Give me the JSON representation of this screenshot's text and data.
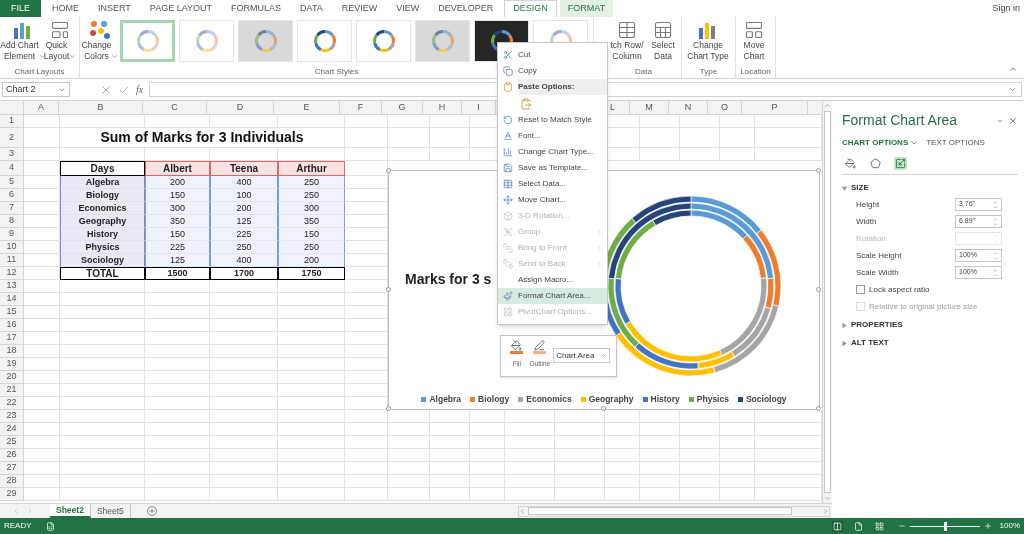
{
  "ribbon_tabs": [
    {
      "label": "FILE",
      "kind": "file",
      "selected": false
    },
    {
      "label": "HOME",
      "kind": "normal",
      "selected": false
    },
    {
      "label": "INSERT",
      "kind": "normal",
      "selected": false
    },
    {
      "label": "PAGE LAYOUT",
      "kind": "normal",
      "selected": false
    },
    {
      "label": "FORMULAS",
      "kind": "normal",
      "selected": false
    },
    {
      "label": "DATA",
      "kind": "normal",
      "selected": false
    },
    {
      "label": "REVIEW",
      "kind": "normal",
      "selected": false
    },
    {
      "label": "VIEW",
      "kind": "normal",
      "selected": false
    },
    {
      "label": "DEVELOPER",
      "kind": "normal",
      "selected": false
    },
    {
      "label": "DESIGN",
      "kind": "contextual",
      "selected": true
    },
    {
      "label": "FORMAT",
      "kind": "contextual",
      "selected": false
    }
  ],
  "account": {
    "label": "Sign in"
  },
  "ribbon": {
    "groups": [
      {
        "label": "Chart Layouts",
        "buttons": [
          {
            "label": "Add Chart\nElement",
            "dropdown": true
          },
          {
            "label": "Quick\nLayout",
            "dropdown": true
          }
        ]
      },
      {
        "label": "Chart Styles",
        "buttons": [
          {
            "label": "Change\nColors",
            "dropdown": true
          }
        ],
        "gallery": [
          {
            "kind": "light",
            "selected": true
          },
          {
            "kind": "light",
            "selected": false
          },
          {
            "kind": "gray",
            "selected": false
          },
          {
            "kind": "vivid",
            "selected": false
          },
          {
            "kind": "vivid",
            "selected": false
          },
          {
            "kind": "gray",
            "selected": false
          },
          {
            "kind": "dark",
            "selected": false
          },
          {
            "kind": "light",
            "selected": false
          }
        ]
      },
      {
        "label": "Data",
        "buttons": [
          {
            "label": "tch Row/\nColumn",
            "dropdown": false
          },
          {
            "label": "Select\nData",
            "dropdown": false
          }
        ]
      },
      {
        "label": "Type",
        "buttons": [
          {
            "label": "Change\nChart Type",
            "dropdown": false
          }
        ]
      },
      {
        "label": "Location",
        "buttons": [
          {
            "label": "Move\nChart",
            "dropdown": false
          }
        ]
      }
    ]
  },
  "formula_bar": {
    "name_box": "Chart 2",
    "function_label": "fx"
  },
  "sheet": {
    "column_headers": [
      "A",
      "B",
      "C",
      "D",
      "E",
      "F",
      "G",
      "H",
      "I",
      "L",
      "M",
      "N",
      "O",
      "P"
    ],
    "row_numbers": [
      "1",
      "2",
      "3",
      "4",
      "5",
      "6",
      "7",
      "8",
      "9",
      "10",
      "11",
      "12",
      "13",
      "14",
      "15",
      "16",
      "17",
      "18",
      "19",
      "20",
      "21",
      "22",
      "23",
      "24",
      "25",
      "26",
      "27",
      "28",
      "29"
    ],
    "title": "Sum of Marks for 3 Individuals",
    "table": {
      "header": [
        "Days",
        "Albert",
        "Teena",
        "Arthur"
      ],
      "rows": [
        [
          "Algebra",
          "200",
          "400",
          "250"
        ],
        [
          "Biology",
          "150",
          "100",
          "250"
        ],
        [
          "Economics",
          "300",
          "200",
          "300"
        ],
        [
          "Geography",
          "350",
          "125",
          "350"
        ],
        [
          "History",
          "150",
          "225",
          "150"
        ],
        [
          "Physics",
          "225",
          "250",
          "250"
        ],
        [
          "Sociology",
          "125",
          "400",
          "200"
        ]
      ],
      "total": [
        "TOTAL",
        "1500",
        "1700",
        "1750"
      ]
    }
  },
  "chart": {
    "title": "Marks for 3 s",
    "chart_data": {
      "type": "donut",
      "categories": [
        "Algebra",
        "Biology",
        "Economics",
        "Geography",
        "History",
        "Physics",
        "Sociology"
      ],
      "series": [
        {
          "colors": [
            "#5b9bd5",
            "#ed7d31",
            "#a5a5a5",
            "#ffc000",
            "#4472c4",
            "#70ad47",
            "#264478"
          ],
          "values": [
            13.3,
            10,
            20,
            23.3,
            10,
            15,
            8.4
          ]
        },
        {
          "colors": [
            "#5b9bd5",
            "#ed7d31",
            "#a5a5a5",
            "#ffc000",
            "#4472c4",
            "#70ad47",
            "#264478"
          ],
          "values": [
            23.5,
            5.9,
            11.8,
            7.4,
            13.2,
            14.7,
            23.5
          ]
        },
        {
          "colors": [
            "#5b9bd5",
            "#ed7d31",
            "#a5a5a5",
            "#ffc000",
            "#4472c4",
            "#70ad47",
            "#264478"
          ],
          "values": [
            14.3,
            14.3,
            17.1,
            20,
            8.6,
            14.3,
            11.4
          ]
        }
      ]
    }
  },
  "mini_toolbar": {
    "buttons": [
      {
        "label": "Fill"
      },
      {
        "label": "Outline"
      }
    ],
    "element_select": "Chart Area"
  },
  "context_menu": [
    {
      "kind": "item",
      "label": "Cut",
      "disabled": false,
      "submenu": false,
      "selected": false
    },
    {
      "kind": "item",
      "label": "Copy",
      "disabled": false,
      "submenu": false,
      "selected": false
    },
    {
      "kind": "header",
      "label": "Paste Options:"
    },
    {
      "kind": "paste-option"
    },
    {
      "kind": "item",
      "label": "Reset to Match Style",
      "disabled": false,
      "submenu": false,
      "selected": false
    },
    {
      "kind": "item",
      "label": "Font...",
      "disabled": false,
      "submenu": false,
      "selected": false
    },
    {
      "kind": "item",
      "label": "Change Chart Type...",
      "disabled": false,
      "submenu": false,
      "selected": false
    },
    {
      "kind": "item",
      "label": "Save as Template...",
      "disabled": false,
      "submenu": false,
      "selected": false
    },
    {
      "kind": "item",
      "label": "Select Data...",
      "disabled": false,
      "submenu": false,
      "selected": false
    },
    {
      "kind": "item",
      "label": "Move Chart...",
      "disabled": false,
      "submenu": false,
      "selected": false
    },
    {
      "kind": "item",
      "label": "3-D Rotation...",
      "disabled": true,
      "submenu": false,
      "selected": false
    },
    {
      "kind": "item",
      "label": "Group",
      "disabled": true,
      "submenu": true,
      "selected": false
    },
    {
      "kind": "item",
      "label": "Bring to Front",
      "disabled": true,
      "submenu": true,
      "selected": false
    },
    {
      "kind": "item",
      "label": "Send to Back",
      "disabled": true,
      "submenu": true,
      "selected": false
    },
    {
      "kind": "item",
      "label": "Assign Macro...",
      "disabled": false,
      "submenu": false,
      "selected": false
    },
    {
      "kind": "item",
      "label": "Format Chart Area...",
      "disabled": false,
      "submenu": false,
      "selected": true
    },
    {
      "kind": "item",
      "label": "PivotChart Options...",
      "disabled": true,
      "submenu": false,
      "selected": false
    }
  ],
  "format_pane": {
    "title": "Format Chart Area",
    "option_tabs": [
      {
        "label": "CHART OPTIONS",
        "selected": true,
        "dropdown": true
      },
      {
        "label": "TEXT OPTIONS",
        "selected": false,
        "dropdown": false
      }
    ],
    "icon_tabs": [
      {
        "selected": false
      },
      {
        "selected": false
      },
      {
        "selected": true
      }
    ],
    "sections": [
      {
        "label": "SIZE",
        "expanded": true,
        "fields": [
          {
            "label": "Height",
            "value": "3.76\"",
            "disabled": false
          },
          {
            "label": "Width",
            "value": "6.89\"",
            "disabled": false
          },
          {
            "label": "Rotation",
            "disabled": true
          },
          {
            "label": "Scale Height",
            "value": "100%",
            "disabled": false
          },
          {
            "label": "Scale Width",
            "value": "100%",
            "disabled": false
          }
        ],
        "checkboxes": [
          {
            "label": "Lock aspect ratio",
            "checked": false,
            "disabled": false
          },
          {
            "label": "Relative to original picture size",
            "checked": false,
            "disabled": true
          }
        ]
      },
      {
        "label": "PROPERTIES",
        "expanded": false
      },
      {
        "label": "ALT TEXT",
        "expanded": false
      }
    ]
  },
  "sheet_tabs": [
    {
      "label": "Sheet2",
      "selected": true
    },
    {
      "label": "Sheet5",
      "selected": false
    }
  ],
  "status_bar": {
    "status": "READY",
    "views": [
      {
        "selected": true
      },
      {
        "selected": false
      },
      {
        "selected": false
      }
    ],
    "zoom": {
      "level": 0.5,
      "label": "100%"
    }
  }
}
